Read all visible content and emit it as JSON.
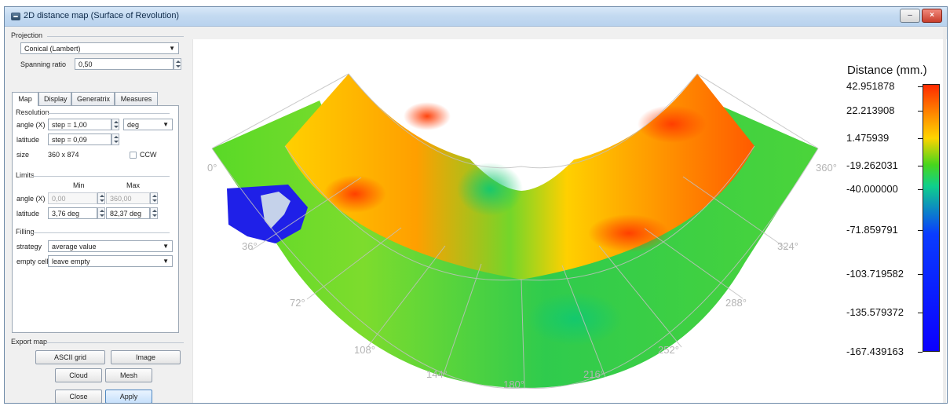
{
  "window": {
    "title": "2D distance map (Surface of Revolution)",
    "minimize_glyph": "–",
    "close_glyph": "×"
  },
  "projection": {
    "group_label": "Projection",
    "selected": "Conical (Lambert)",
    "spanning_label": "Spanning ratio",
    "spanning_value": "0,50"
  },
  "tabs": [
    "Map",
    "Display",
    "Generatrix",
    "Measures"
  ],
  "resolution": {
    "group_label": "Resolution",
    "angle_label": "angle (X)",
    "angle_value": "step = 1,00",
    "angle_unit": "deg",
    "latitude_label": "latitude",
    "latitude_value": "step = 0,09",
    "size_label": "size",
    "size_value": "360 x 874",
    "ccw_label": "CCW"
  },
  "limits": {
    "group_label": "Limits",
    "min_label": "Min",
    "max_label": "Max",
    "angle_label": "angle (X)",
    "angle_min": "0,00",
    "angle_max": "360,00",
    "latitude_label": "latitude",
    "latitude_min": "3,76 deg",
    "latitude_max": "82,37 deg"
  },
  "filling": {
    "group_label": "Filling",
    "strategy_label": "strategy",
    "strategy_value": "average value",
    "empty_label": "empty cells",
    "empty_value": "leave empty"
  },
  "export": {
    "group_label": "Export map",
    "ascii_button": "ASCII grid",
    "image_button": "Image",
    "cloud_button": "Cloud",
    "mesh_button": "Mesh"
  },
  "footer": {
    "close_button": "Close",
    "apply_button": "Apply"
  },
  "plot": {
    "axis_labels": [
      "0°",
      "36°",
      "72°",
      "108°",
      "144°",
      "180°",
      "216°",
      "252°",
      "288°",
      "324°",
      "360°"
    ]
  },
  "colorbar": {
    "title": "Distance (mm.)",
    "ticks": [
      "42.951878",
      "22.213908",
      "1.475939",
      "-19.262031",
      "-40.000000",
      "-71.859791",
      "-103.719582",
      "-135.579372",
      "-167.439163"
    ]
  },
  "colors": {
    "window_bg": "#f0f0f0",
    "title_accent": "#0f2b4a",
    "plot_bg": "#ffffff",
    "grid_gray": "#c0c0c0",
    "high_red": "#ff2a00",
    "mid_yellow": "#ffd400",
    "mid_green": "#48d61d",
    "low_blue": "#0b00ff"
  },
  "icons": {
    "app": "app-icon",
    "minimize": "minimize-icon",
    "close": "close-icon",
    "dropdown": "chevron-down-icon",
    "spin": "spinner-icon",
    "checkbox": "checkbox-icon"
  }
}
